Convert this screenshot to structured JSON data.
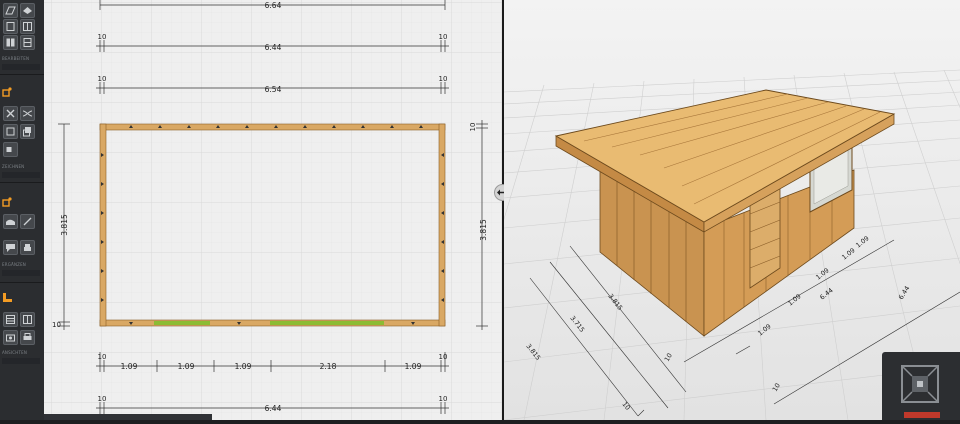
{
  "toolbar": {
    "sections": [
      {
        "label": "BEARBEITEN"
      },
      {
        "label": "ZEICHNEN"
      },
      {
        "label": "ERGÄNZEN"
      },
      {
        "label": "ANSICHTEN"
      }
    ]
  },
  "plan_view": {
    "dims_top": {
      "total_outer": "6.64",
      "left_offset": "10",
      "right_offset": "10",
      "inner": "6.44",
      "middle": "6.54"
    },
    "dims_side": {
      "left_height": "3.815",
      "right_height": "3.815",
      "bottom_offset": "10",
      "top_offset": "10"
    },
    "dims_bottom": {
      "segments": [
        "1.09",
        "1.09",
        "1.09",
        "2.18",
        "1.09"
      ],
      "offset_left": "10",
      "offset_right": "10",
      "total": "6.44",
      "offset_left_2": "10",
      "offset_right_2": "10"
    }
  },
  "view_3d": {
    "labels": {
      "front_total": "6.44",
      "front_seg1": "1.09",
      "front_seg2": "1.09",
      "front_seg3": "1.09",
      "front_seg4": "1.09",
      "front_seg5": "1.09",
      "front_offset_a": "10",
      "front_offset_b": "10",
      "depth_a": "3.815",
      "depth_b": "3.715",
      "depth_c": "3.815",
      "depth_offset": "10"
    }
  },
  "colors": {
    "wall": "#d9a864",
    "wall_dark": "#b6833f",
    "door": "#8cbc34",
    "grid": "#dcdcdc",
    "dark_ui": "#2b2d30"
  }
}
